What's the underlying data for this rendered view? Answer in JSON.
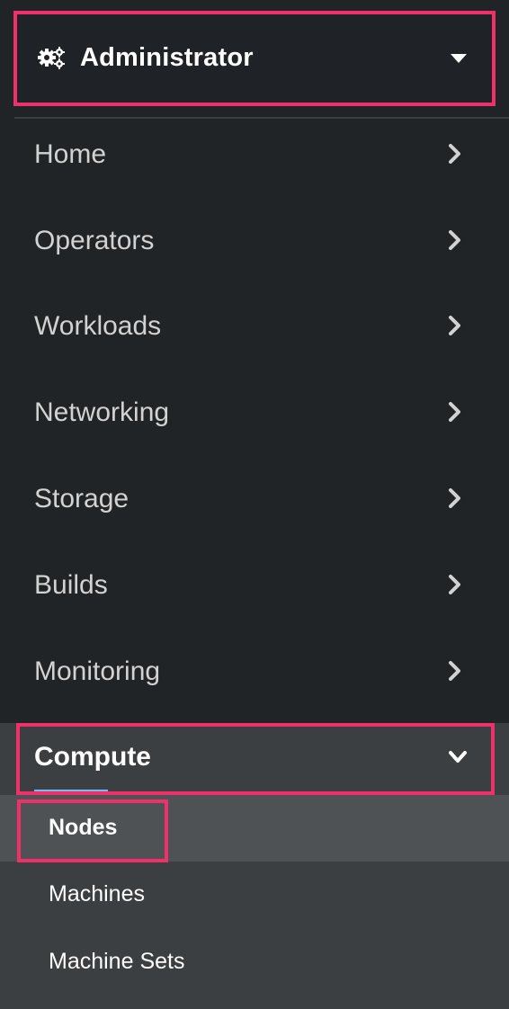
{
  "perspective": {
    "title": "Administrator",
    "icon": "cogs-icon"
  },
  "menu": [
    {
      "label": "Home",
      "icon": "chevron-right-icon"
    },
    {
      "label": "Operators",
      "icon": "chevron-right-icon"
    },
    {
      "label": "Workloads",
      "icon": "chevron-right-icon"
    },
    {
      "label": "Networking",
      "icon": "chevron-right-icon"
    },
    {
      "label": "Storage",
      "icon": "chevron-right-icon"
    },
    {
      "label": "Builds",
      "icon": "chevron-right-icon"
    },
    {
      "label": "Monitoring",
      "icon": "chevron-right-icon"
    }
  ],
  "compute": {
    "label": "Compute",
    "icon": "chevron-down-icon",
    "items": [
      {
        "label": "Nodes",
        "active": true
      },
      {
        "label": "Machines",
        "active": false
      },
      {
        "label": "Machine Sets",
        "active": false
      }
    ]
  },
  "colors": {
    "background": "#212427",
    "highlight_border": "#f0306b",
    "expanded_section": "#3c3f42",
    "active_item": "#4f5255",
    "accent_underline": "#73bcf7"
  }
}
